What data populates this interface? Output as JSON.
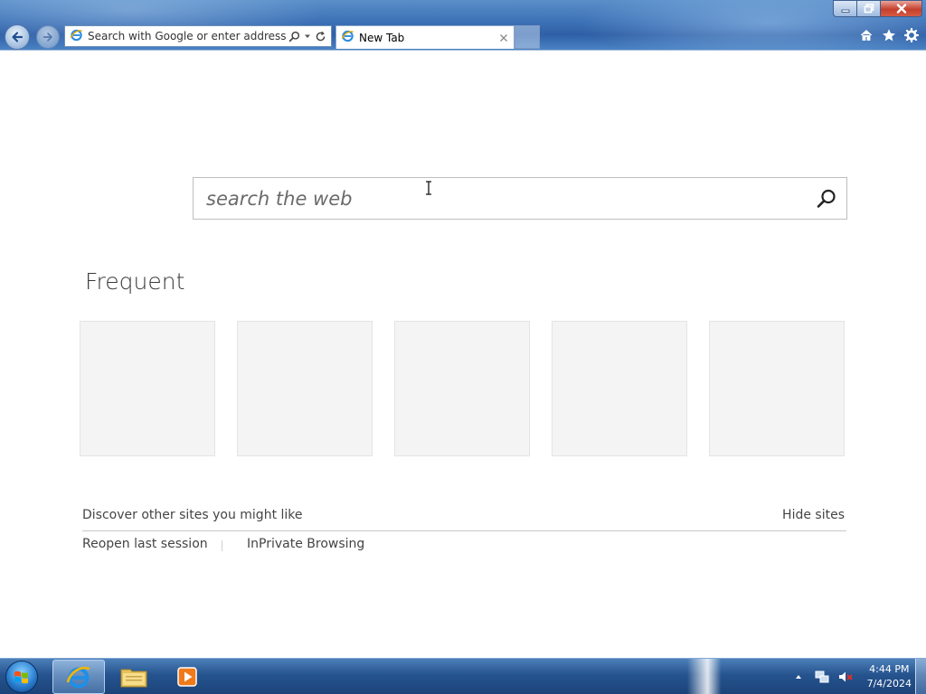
{
  "browser": {
    "address_placeholder": "Search with Google or enter address",
    "tab_title": "New Tab",
    "icons": {
      "back": "back-arrow-icon",
      "forward": "forward-arrow-icon",
      "page": "ie-page-icon",
      "search": "magnifier-icon",
      "dropdown": "chevron-down-icon",
      "refresh": "refresh-icon",
      "close_tab": "close-icon",
      "home": "home-icon",
      "favorites": "star-icon",
      "tools": "gear-icon"
    },
    "window_buttons": {
      "minimize": "minimize-icon",
      "restore": "restore-icon",
      "close": "close-icon"
    }
  },
  "newtab": {
    "search_placeholder": "search the web",
    "frequent_title": "Frequent",
    "tile_count": 5,
    "discover_label": "Discover other sites you might like",
    "hide_sites_label": "Hide sites",
    "reopen_label": "Reopen last session",
    "inprivate_label": "InPrivate Browsing"
  },
  "taskbar": {
    "pinned": [
      "internet-explorer",
      "file-explorer",
      "media-player"
    ],
    "clock_time": "4:44 PM",
    "clock_date": "7/4/2024",
    "tray_icons": [
      "show-hidden-icons-arrow",
      "network-icon",
      "volume-muted-icon"
    ]
  },
  "colors": {
    "chrome_blue": "#3f74b8",
    "tile_bg": "#f4f4f4",
    "taskbar_blue": "#26548f",
    "close_red": "#c4402d"
  }
}
